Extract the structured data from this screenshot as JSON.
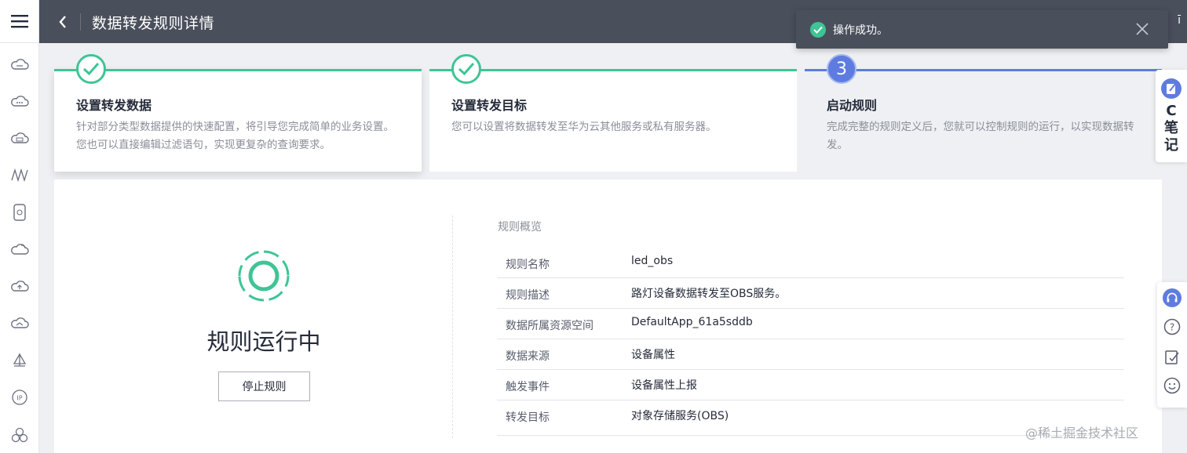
{
  "header": {
    "title": "数据转发规则详情",
    "right_glyph": "ī"
  },
  "toast": {
    "message": "操作成功。"
  },
  "steps": [
    {
      "title": "设置转发数据",
      "desc": "针对部分类型数据提供的快速配置，将引导您完成简单的业务设置。您也可以直接编辑过滤语句，实现更复杂的查询要求。",
      "state": "done"
    },
    {
      "title": "设置转发目标",
      "desc": "您可以设置将数据转发至华为云其他服务或私有服务器。",
      "state": "done"
    },
    {
      "title": "启动规则",
      "desc": "完成完整的规则定义后，您就可以控制规则的运行，以实现数据转发。",
      "state": "current",
      "number": "3"
    }
  ],
  "status": {
    "text": "规则运行中",
    "stop_button": "停止规则"
  },
  "overview": {
    "title": "规则概览",
    "rows": [
      {
        "label": "规则名称",
        "value": "led_obs"
      },
      {
        "label": "规则描述",
        "value": "路灯设备数据转发至OBS服务。"
      },
      {
        "label": "数据所属资源空间",
        "value": "DefaultApp_61a5sddb"
      },
      {
        "label": "数据来源",
        "value": "设备属性"
      },
      {
        "label": "触发事件",
        "value": "设备属性上报"
      },
      {
        "label": "转发目标",
        "value": "对象存储服务(OBS)"
      }
    ]
  },
  "notes": {
    "label_1": "C",
    "label_2": "笔",
    "label_3": "记"
  },
  "watermark": "@稀土掘金技术社区",
  "colors": {
    "header_bg": "#4a4f5c",
    "success": "#3ec595",
    "accent": "#5e7ce0"
  },
  "icons": {
    "rail": [
      "cloud-server-icon",
      "cloud-dots-icon",
      "cloud-database-icon",
      "waveform-icon",
      "device-icon",
      "cloud-sync-icon",
      "cloud-upload-icon",
      "cloud-network-icon",
      "sail-icon",
      "ip-icon",
      "cluster-icon"
    ],
    "tools": [
      "headset-icon",
      "help-icon",
      "edit-icon",
      "smile-icon"
    ]
  }
}
